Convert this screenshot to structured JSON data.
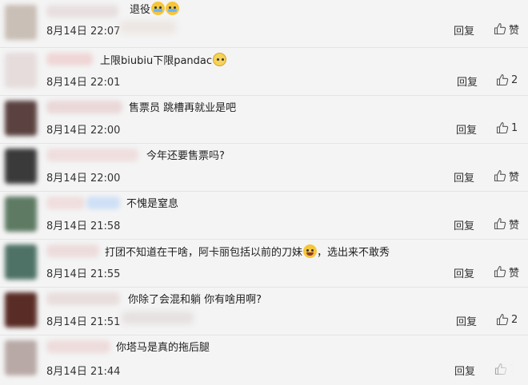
{
  "labels": {
    "reply": "回复",
    "like": "赞"
  },
  "comments": [
    {
      "text": "退役",
      "time": "8月14日 22:07",
      "likes": "",
      "emoji": "cry"
    },
    {
      "text": "上限biubiu下限pandac",
      "time": "8月14日 22:01",
      "likes": "2",
      "emoji": "panda"
    },
    {
      "text": "售票员 跳槽再就业是吧",
      "time": "8月14日 22:00",
      "likes": "1",
      "emoji": ""
    },
    {
      "text": "今年还要售票吗?",
      "time": "8月14日 22:00",
      "likes": "",
      "emoji": ""
    },
    {
      "text": "不愧是窒息",
      "time": "8月14日 21:58",
      "likes": "",
      "emoji": ""
    },
    {
      "text": "打团不知道在干啥，阿卡丽包括以前的刀妹",
      "text_tail": "，选出来不敢秀",
      "time": "8月14日 21:55",
      "likes": "",
      "emoji": "laugh"
    },
    {
      "text": "你除了会混和躺 你有啥用啊?",
      "time": "8月14日 21:51",
      "likes": "2",
      "emoji": ""
    },
    {
      "text": "你塔马是真的拖后腿",
      "time": "8月14日 21:44",
      "likes": "1",
      "emoji": ""
    }
  ]
}
